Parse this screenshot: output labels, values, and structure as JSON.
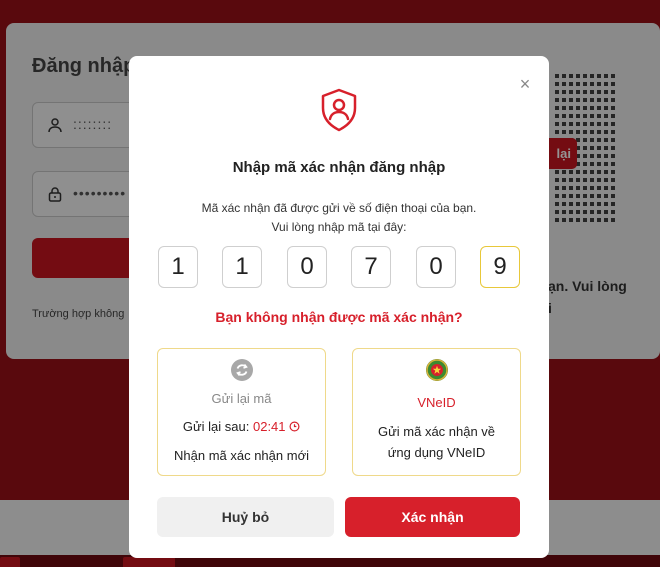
{
  "background": {
    "login_title": "Đăng nhập",
    "username_value": "::::::::",
    "password_value": "•••••••••",
    "help_text": "Trường hợp không",
    "retry_label": "lại",
    "qr_note": "ạn. Vui lòng\ni"
  },
  "modal": {
    "close_icon": "×",
    "title": "Nhập mã xác nhận đăng nhập",
    "desc_line1": "Mã xác nhận đã được gửi về số điện thoại của bạn.",
    "desc_line2": "Vui lòng nhập mã tại đây:",
    "otp_digits": [
      "1",
      "1",
      "0",
      "7",
      "0",
      "9"
    ],
    "resend_question": "Bạn không nhận được mã xác nhận?",
    "resend_option": {
      "icon": "refresh-icon",
      "title": "Gửi lại mã",
      "countdown_label": "Gửi lại sau:",
      "countdown_value": "02:41",
      "subtitle": "Nhận mã xác nhận mới"
    },
    "vneid_option": {
      "icon": "vneid-emblem-icon",
      "title": "VNeID",
      "desc_line1": "Gửi mã xác nhận về",
      "desc_line2": "ứng dụng VNeID"
    },
    "cancel_label": "Huỷ bỏ",
    "confirm_label": "Xác nhận"
  },
  "colors": {
    "accent": "#d7202b",
    "card_border": "#efd98a",
    "active_otp_border": "#e8c83a"
  }
}
